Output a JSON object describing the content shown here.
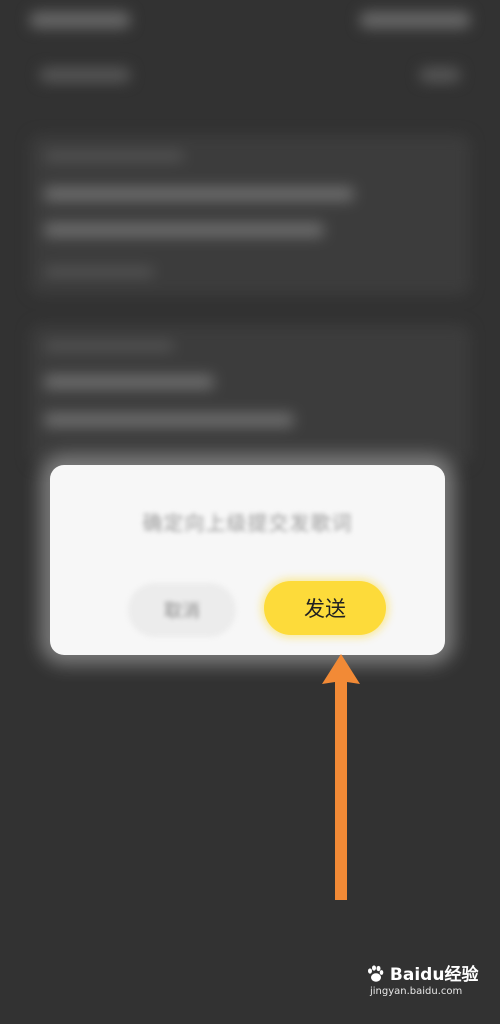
{
  "dialog": {
    "message": "确定向上级提交发歌词",
    "cancel_label": "取消",
    "send_label": "发送"
  },
  "colors": {
    "send_button": "#FDDB3A",
    "arrow": "#F28A36",
    "overlay": "#323232"
  },
  "watermark": {
    "brand": "Baidu经验",
    "url": "jingyan.baidu.com"
  },
  "icons": {
    "annotation": "up-arrow-icon",
    "logo": "baidu-paw-icon"
  }
}
